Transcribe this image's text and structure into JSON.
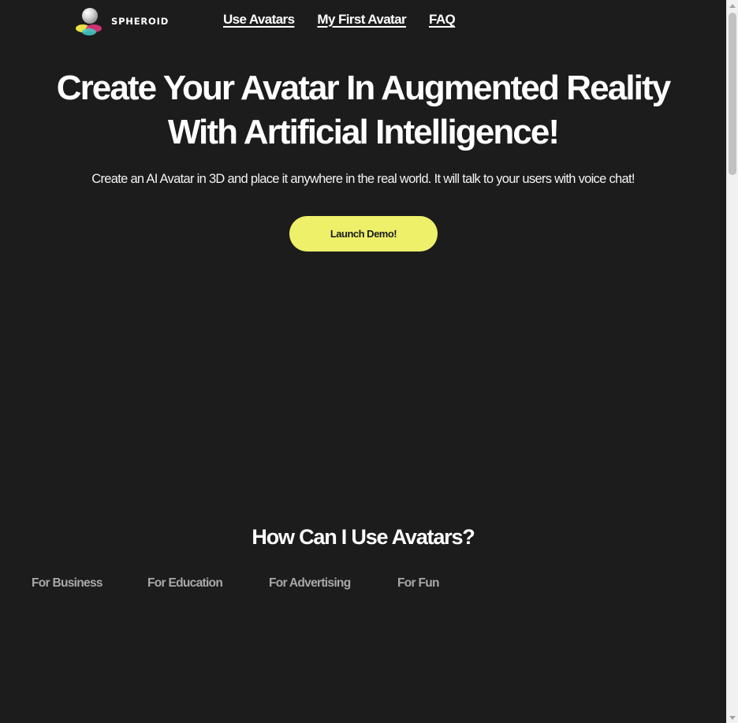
{
  "brand": {
    "name": "SPHEROID",
    "logo_icon": "spheroid-logo-icon"
  },
  "nav": {
    "items": [
      {
        "label": "Use Avatars"
      },
      {
        "label": "My First Avatar"
      },
      {
        "label": "FAQ"
      }
    ]
  },
  "hero": {
    "title_line1": "Create Your Avatar In Augmented Reality",
    "title_line2": "With Artificial Intelligence!",
    "subtitle": "Create an AI Avatar in 3D and place it anywhere in the real world. It will talk to your users with voice chat!",
    "cta_label": "Launch Demo!"
  },
  "use_cases": {
    "title": "How Can I Use Avatars?",
    "tabs": [
      {
        "label": "For Business"
      },
      {
        "label": "For Education"
      },
      {
        "label": "For Advertising"
      },
      {
        "label": "For Fun"
      }
    ]
  },
  "colors": {
    "background": "#1c1c1c",
    "accent": "#eef06a",
    "text": "#ffffff",
    "muted": "#a8a8a8"
  }
}
